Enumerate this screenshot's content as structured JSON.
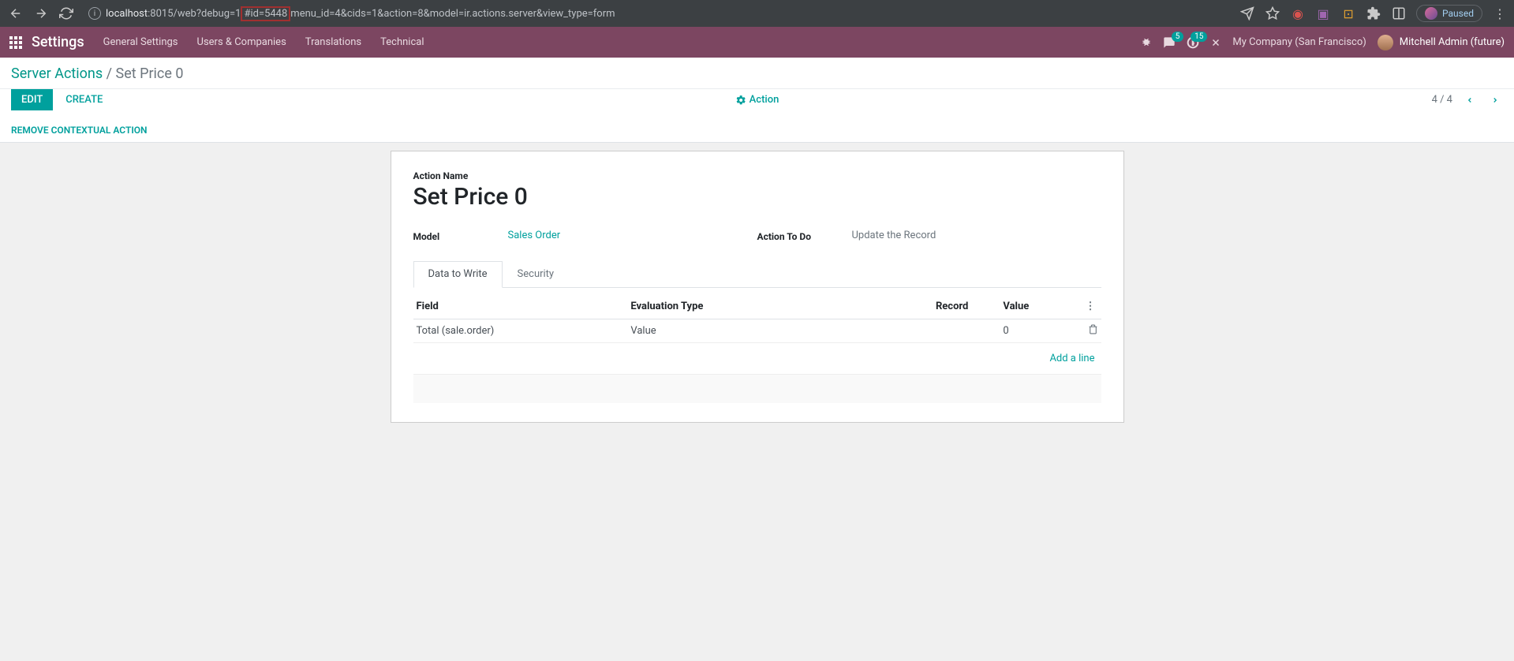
{
  "browser": {
    "url_domain": "localhost",
    "url_port": ":8015",
    "url_path_before": "/web?debug=1",
    "url_highlight": "#id=5448",
    "url_path_after": "menu_id=4&cids=1&action=8&model=ir.actions.server&view_type=form",
    "paused_label": "Paused"
  },
  "nav": {
    "app": "Settings",
    "menu": [
      "General Settings",
      "Users & Companies",
      "Translations",
      "Technical"
    ],
    "badge_msg": "5",
    "badge_activity": "15",
    "company": "My Company (San Francisco)",
    "user": "Mitchell Admin (future)"
  },
  "breadcrumb": {
    "parent": "Server Actions",
    "current": "Set Price 0"
  },
  "controls": {
    "edit": "EDIT",
    "create": "CREATE",
    "action_link": "Action",
    "pager": "4 / 4",
    "remove_action": "REMOVE CONTEXTUAL ACTION"
  },
  "form": {
    "name_label": "Action Name",
    "name_value": "Set Price 0",
    "model_label": "Model",
    "model_value": "Sales Order",
    "action_label": "Action To Do",
    "action_value": "Update the Record",
    "tabs": [
      "Data to Write",
      "Security"
    ],
    "table": {
      "headers": [
        "Field",
        "Evaluation Type",
        "Record",
        "Value"
      ],
      "rows": [
        {
          "field": "Total (sale.order)",
          "eval_type": "Value",
          "record": "",
          "value": "0"
        }
      ],
      "add_line": "Add a line"
    }
  }
}
